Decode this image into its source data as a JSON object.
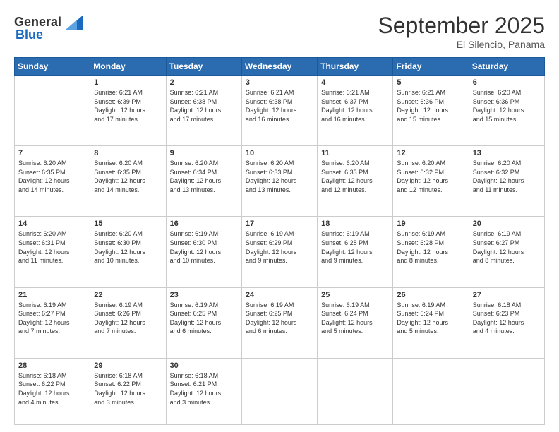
{
  "logo": {
    "general": "General",
    "blue": "Blue"
  },
  "header": {
    "month": "September 2025",
    "location": "El Silencio, Panama"
  },
  "weekdays": [
    "Sunday",
    "Monday",
    "Tuesday",
    "Wednesday",
    "Thursday",
    "Friday",
    "Saturday"
  ],
  "weeks": [
    [
      {
        "day": "",
        "info": ""
      },
      {
        "day": "1",
        "info": "Sunrise: 6:21 AM\nSunset: 6:39 PM\nDaylight: 12 hours\nand 17 minutes."
      },
      {
        "day": "2",
        "info": "Sunrise: 6:21 AM\nSunset: 6:38 PM\nDaylight: 12 hours\nand 17 minutes."
      },
      {
        "day": "3",
        "info": "Sunrise: 6:21 AM\nSunset: 6:38 PM\nDaylight: 12 hours\nand 16 minutes."
      },
      {
        "day": "4",
        "info": "Sunrise: 6:21 AM\nSunset: 6:37 PM\nDaylight: 12 hours\nand 16 minutes."
      },
      {
        "day": "5",
        "info": "Sunrise: 6:21 AM\nSunset: 6:36 PM\nDaylight: 12 hours\nand 15 minutes."
      },
      {
        "day": "6",
        "info": "Sunrise: 6:20 AM\nSunset: 6:36 PM\nDaylight: 12 hours\nand 15 minutes."
      }
    ],
    [
      {
        "day": "7",
        "info": "Sunrise: 6:20 AM\nSunset: 6:35 PM\nDaylight: 12 hours\nand 14 minutes."
      },
      {
        "day": "8",
        "info": "Sunrise: 6:20 AM\nSunset: 6:35 PM\nDaylight: 12 hours\nand 14 minutes."
      },
      {
        "day": "9",
        "info": "Sunrise: 6:20 AM\nSunset: 6:34 PM\nDaylight: 12 hours\nand 13 minutes."
      },
      {
        "day": "10",
        "info": "Sunrise: 6:20 AM\nSunset: 6:33 PM\nDaylight: 12 hours\nand 13 minutes."
      },
      {
        "day": "11",
        "info": "Sunrise: 6:20 AM\nSunset: 6:33 PM\nDaylight: 12 hours\nand 12 minutes."
      },
      {
        "day": "12",
        "info": "Sunrise: 6:20 AM\nSunset: 6:32 PM\nDaylight: 12 hours\nand 12 minutes."
      },
      {
        "day": "13",
        "info": "Sunrise: 6:20 AM\nSunset: 6:32 PM\nDaylight: 12 hours\nand 11 minutes."
      }
    ],
    [
      {
        "day": "14",
        "info": "Sunrise: 6:20 AM\nSunset: 6:31 PM\nDaylight: 12 hours\nand 11 minutes."
      },
      {
        "day": "15",
        "info": "Sunrise: 6:20 AM\nSunset: 6:30 PM\nDaylight: 12 hours\nand 10 minutes."
      },
      {
        "day": "16",
        "info": "Sunrise: 6:19 AM\nSunset: 6:30 PM\nDaylight: 12 hours\nand 10 minutes."
      },
      {
        "day": "17",
        "info": "Sunrise: 6:19 AM\nSunset: 6:29 PM\nDaylight: 12 hours\nand 9 minutes."
      },
      {
        "day": "18",
        "info": "Sunrise: 6:19 AM\nSunset: 6:28 PM\nDaylight: 12 hours\nand 9 minutes."
      },
      {
        "day": "19",
        "info": "Sunrise: 6:19 AM\nSunset: 6:28 PM\nDaylight: 12 hours\nand 8 minutes."
      },
      {
        "day": "20",
        "info": "Sunrise: 6:19 AM\nSunset: 6:27 PM\nDaylight: 12 hours\nand 8 minutes."
      }
    ],
    [
      {
        "day": "21",
        "info": "Sunrise: 6:19 AM\nSunset: 6:27 PM\nDaylight: 12 hours\nand 7 minutes."
      },
      {
        "day": "22",
        "info": "Sunrise: 6:19 AM\nSunset: 6:26 PM\nDaylight: 12 hours\nand 7 minutes."
      },
      {
        "day": "23",
        "info": "Sunrise: 6:19 AM\nSunset: 6:25 PM\nDaylight: 12 hours\nand 6 minutes."
      },
      {
        "day": "24",
        "info": "Sunrise: 6:19 AM\nSunset: 6:25 PM\nDaylight: 12 hours\nand 6 minutes."
      },
      {
        "day": "25",
        "info": "Sunrise: 6:19 AM\nSunset: 6:24 PM\nDaylight: 12 hours\nand 5 minutes."
      },
      {
        "day": "26",
        "info": "Sunrise: 6:19 AM\nSunset: 6:24 PM\nDaylight: 12 hours\nand 5 minutes."
      },
      {
        "day": "27",
        "info": "Sunrise: 6:18 AM\nSunset: 6:23 PM\nDaylight: 12 hours\nand 4 minutes."
      }
    ],
    [
      {
        "day": "28",
        "info": "Sunrise: 6:18 AM\nSunset: 6:22 PM\nDaylight: 12 hours\nand 4 minutes."
      },
      {
        "day": "29",
        "info": "Sunrise: 6:18 AM\nSunset: 6:22 PM\nDaylight: 12 hours\nand 3 minutes."
      },
      {
        "day": "30",
        "info": "Sunrise: 6:18 AM\nSunset: 6:21 PM\nDaylight: 12 hours\nand 3 minutes."
      },
      {
        "day": "",
        "info": ""
      },
      {
        "day": "",
        "info": ""
      },
      {
        "day": "",
        "info": ""
      },
      {
        "day": "",
        "info": ""
      }
    ]
  ]
}
